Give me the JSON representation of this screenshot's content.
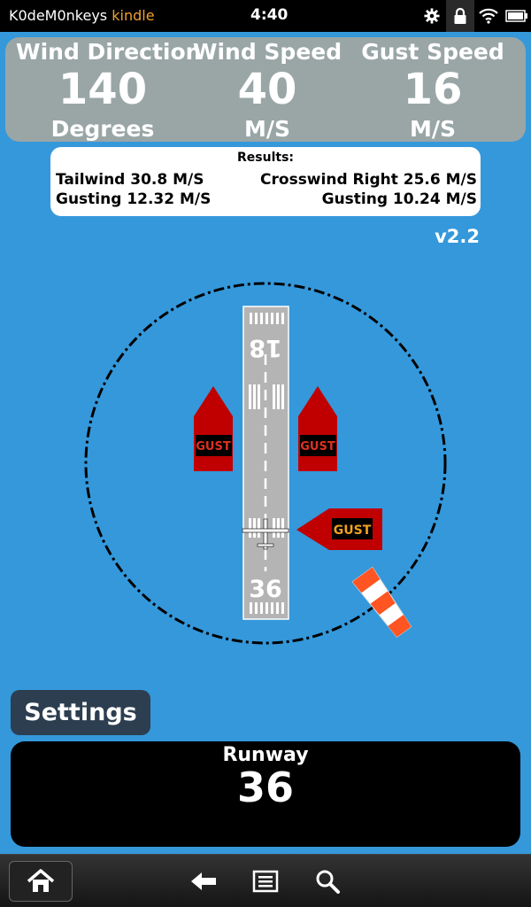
{
  "status_bar": {
    "brand_prefix": "K0deM0nkeys",
    "brand_suffix": "kindle",
    "time": "4:40"
  },
  "wind": {
    "direction": {
      "label": "Wind Direction",
      "value": "140",
      "unit": "Degrees"
    },
    "speed": {
      "label": "Wind Speed",
      "value": "40",
      "unit": "M/S"
    },
    "gust": {
      "label": "Gust Speed",
      "value": "16",
      "unit": "M/S"
    }
  },
  "results": {
    "title": "Results:",
    "tailwind": "Tailwind 30.8 M/S",
    "tail_gusting": "Gusting 12.32 M/S",
    "crosswind": "Crosswind Right 25.6 M/S",
    "cross_gusting": "Gusting 10.24 M/S"
  },
  "version": "v2.2",
  "diagram": {
    "runway_top_number": "18",
    "runway_bottom_number": "36",
    "gust_label": "GUST",
    "wind_direction_degrees": 140,
    "colors": {
      "arrow": "#c00000",
      "gust_text_tail": "#e03020",
      "gust_text_cross": "#f0a020",
      "runway": "#b4b4b4",
      "windsock": "#ff5522"
    }
  },
  "settings_label": "Settings",
  "runway": {
    "label": "Runway",
    "value": "36"
  },
  "icons": {
    "status": [
      "gear-icon",
      "lock-icon",
      "wifi-icon",
      "battery-icon"
    ],
    "nav": [
      "home-icon",
      "back-icon",
      "menu-icon",
      "search-icon"
    ]
  }
}
